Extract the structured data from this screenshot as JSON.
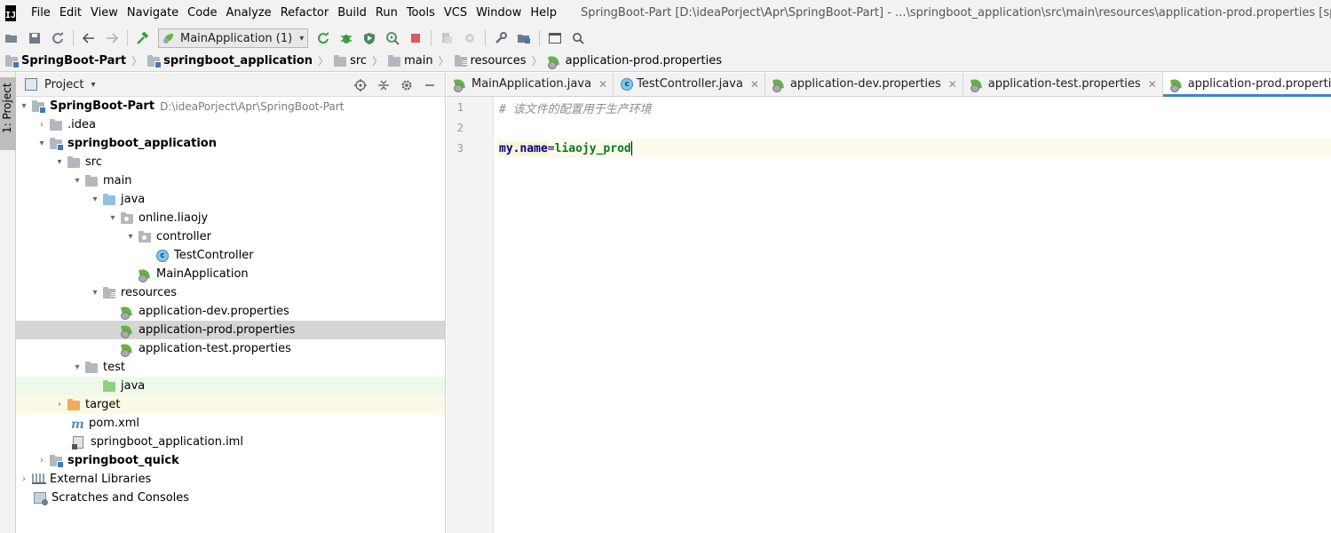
{
  "menu": {
    "logo": "IJ",
    "items": [
      "File",
      "Edit",
      "View",
      "Navigate",
      "Code",
      "Analyze",
      "Refactor",
      "Build",
      "Run",
      "Tools",
      "VCS",
      "Window",
      "Help"
    ],
    "window_title": "SpringBoot-Part [D:\\ideaPorject\\Apr\\SpringBoot-Part] - ...\\springboot_application\\src\\main\\resources\\application-prod.properties [springboot_application]"
  },
  "toolbar": {
    "run_config": "MainApplication (1)",
    "icons": [
      "folder-open-icon",
      "save-icon",
      "sync-icon",
      "back-icon",
      "forward-icon",
      "build-icon",
      "run-icon",
      "debug-icon",
      "coverage-icon",
      "profile-icon",
      "stop-icon",
      "vcs-update-icon",
      "vcs-commit-icon",
      "settings-icon",
      "project-structure-icon",
      "terminal-icon",
      "search-icon"
    ]
  },
  "breadcrumb": {
    "items": [
      {
        "label": "SpringBoot-Part",
        "icon": "module-folder-icon",
        "bold": true
      },
      {
        "label": "springboot_application",
        "icon": "module-folder-icon",
        "bold": true
      },
      {
        "label": "src",
        "icon": "folder-icon",
        "bold": false
      },
      {
        "label": "main",
        "icon": "folder-icon",
        "bold": false
      },
      {
        "label": "resources",
        "icon": "resources-folder-icon",
        "bold": false
      },
      {
        "label": "application-prod.properties",
        "icon": "spring-properties-icon",
        "bold": false
      }
    ]
  },
  "left_stripe": {
    "project_tab": "1: Project"
  },
  "project_panel": {
    "title": "Project",
    "tree": [
      {
        "label": "SpringBoot-Part",
        "path": "D:\\ideaPorject\\Apr\\SpringBoot-Part",
        "depth": 0,
        "expanded": true,
        "icon": "module-folder",
        "bold": true
      },
      {
        "label": ".idea",
        "depth": 1,
        "expanded": false,
        "icon": "folder"
      },
      {
        "label": "springboot_application",
        "depth": 1,
        "expanded": true,
        "icon": "module-folder",
        "bold": true
      },
      {
        "label": "src",
        "depth": 2,
        "expanded": true,
        "icon": "folder"
      },
      {
        "label": "main",
        "depth": 3,
        "expanded": true,
        "icon": "folder"
      },
      {
        "label": "java",
        "depth": 4,
        "expanded": true,
        "icon": "source-folder"
      },
      {
        "label": "online.liaojy",
        "depth": 5,
        "expanded": true,
        "icon": "package"
      },
      {
        "label": "controller",
        "depth": 6,
        "expanded": true,
        "icon": "package"
      },
      {
        "label": "TestController",
        "depth": 7,
        "icon": "class"
      },
      {
        "label": "MainApplication",
        "depth": 6,
        "icon": "spring-class"
      },
      {
        "label": "resources",
        "depth": 4,
        "expanded": true,
        "icon": "resources-folder"
      },
      {
        "label": "application-dev.properties",
        "depth": 5,
        "icon": "spring-properties"
      },
      {
        "label": "application-prod.properties",
        "depth": 5,
        "icon": "spring-properties",
        "selected": true
      },
      {
        "label": "application-test.properties",
        "depth": 5,
        "icon": "spring-properties"
      },
      {
        "label": "test",
        "depth": 3,
        "expanded": true,
        "icon": "folder"
      },
      {
        "label": "java",
        "depth": 4,
        "icon": "test-folder",
        "highlight": "green"
      },
      {
        "label": "target",
        "depth": 2,
        "expanded": false,
        "icon": "excluded-folder",
        "highlight": "yellow"
      },
      {
        "label": "pom.xml",
        "depth": 2,
        "icon": "maven"
      },
      {
        "label": "springboot_application.iml",
        "depth": 2,
        "icon": "iml"
      },
      {
        "label": "springboot_quick",
        "depth": 1,
        "expanded": false,
        "icon": "module-folder",
        "bold": true
      },
      {
        "label": "External Libraries",
        "depth": 0,
        "expanded": false,
        "icon": "libraries"
      },
      {
        "label": "Scratches and Consoles",
        "depth": 0,
        "icon": "scratches"
      }
    ]
  },
  "editor_tabs": [
    {
      "label": "MainApplication.java",
      "icon": "spring-class",
      "active": false
    },
    {
      "label": "TestController.java",
      "icon": "class",
      "active": false
    },
    {
      "label": "application-dev.properties",
      "icon": "spring-properties",
      "active": false
    },
    {
      "label": "application-test.properties",
      "icon": "spring-properties",
      "active": false
    },
    {
      "label": "application-prod.properties",
      "icon": "spring-properties",
      "active": true
    }
  ],
  "editor": {
    "lines": [
      {
        "number": "1",
        "comment": "# 该文件的配置用于生产环境"
      },
      {
        "number": "2"
      },
      {
        "number": "3",
        "key": "my.name",
        "eq": "=",
        "value": "liaojy_prod",
        "current": true
      }
    ]
  }
}
